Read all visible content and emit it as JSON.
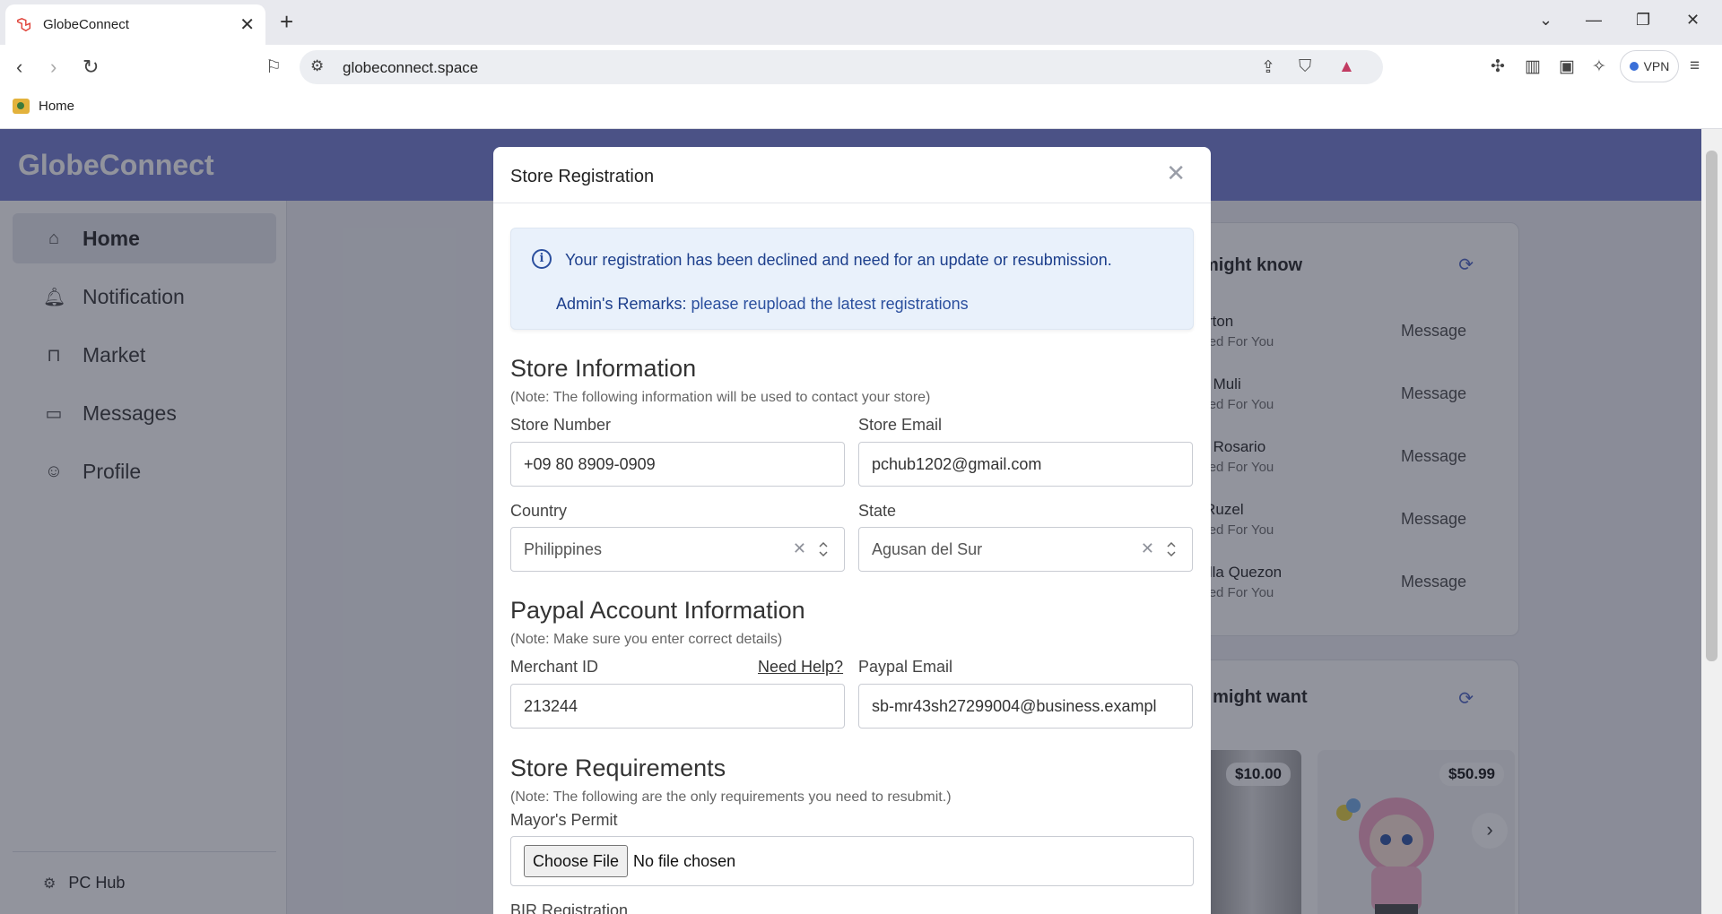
{
  "browser": {
    "tab_title": "GlobeConnect",
    "url": "globeconnect.space",
    "vpn_label": "VPN",
    "bookmark_home": "Home"
  },
  "app": {
    "brand": "GlobeConnect",
    "nav": [
      {
        "label": "Home",
        "icon": "home-icon"
      },
      {
        "label": "Notification",
        "icon": "bell-icon"
      },
      {
        "label": "Market",
        "icon": "bag-icon"
      },
      {
        "label": "Messages",
        "icon": "chat-icon"
      },
      {
        "label": "Profile",
        "icon": "user-icon"
      }
    ],
    "footer_label": "PC Hub",
    "people_card": {
      "title": "ou might know",
      "people": [
        {
          "name": "n Burton",
          "sub": "ggested For You",
          "action": "Message"
        },
        {
          "name": "richo Muli",
          "sub": "ggested For You",
          "action": "Message"
        },
        {
          "name": "yden Rosario",
          "sub": "ggested For You",
          "action": "Message"
        },
        {
          "name": "nce Ruzel",
          "sub": "ggested For You",
          "action": "Message"
        },
        {
          "name": "chaella Quezon",
          "sub": "ggested For You",
          "action": "Message"
        }
      ]
    },
    "products_card": {
      "title": "you might want",
      "products": [
        {
          "price": "$10.00"
        },
        {
          "price": "$50.99"
        }
      ]
    }
  },
  "modal": {
    "title": "Store Registration",
    "alert": {
      "message": "Your registration has been declined and need for an update or resubmission.",
      "remarks_label": "Admin's Remarks:",
      "remarks_text": " please reupload the latest registrations"
    },
    "store_info": {
      "title": "Store Information",
      "note": "(Note: The following information will be used to contact your store)",
      "store_number_label": "Store Number",
      "store_number": "+09 80 8909-0909",
      "store_email_label": "Store Email",
      "store_email": "pchub1202@gmail.com",
      "country_label": "Country",
      "country": "Philippines",
      "state_label": "State",
      "state": "Agusan del Sur"
    },
    "paypal": {
      "title": "Paypal Account Information",
      "note": "(Note: Make sure you enter correct details)",
      "merchant_label": "Merchant ID",
      "help_link": "Need Help?",
      "merchant_id": "213244",
      "email_label": "Paypal Email",
      "email": "sb-mr43sh27299004@business.exampl"
    },
    "requirements": {
      "title": "Store Requirements",
      "note": "(Note: The following are the only requirements you need to resubmit.)",
      "mayor_label": "Mayor's Permit",
      "choose_file": "Choose File",
      "no_file": "No file chosen",
      "bir_label": "BIR Registration"
    }
  }
}
